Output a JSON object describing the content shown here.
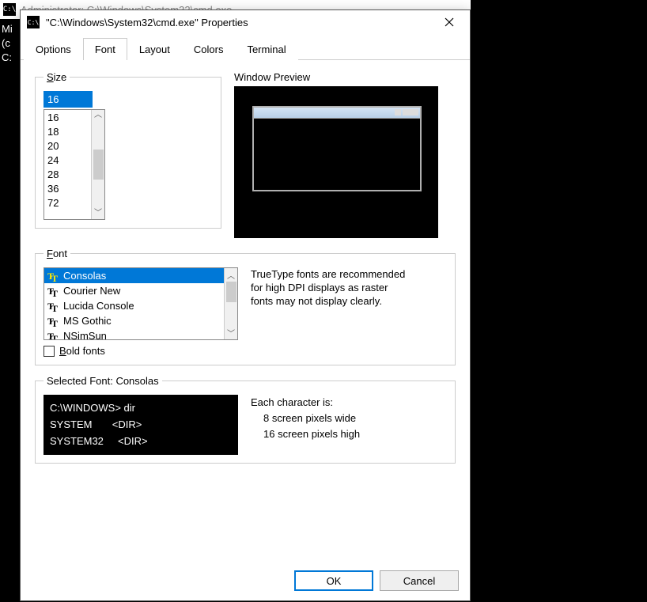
{
  "background": {
    "title_text": "Administrator: C:\\Windows\\System32\\cmd.exe",
    "left_lines": [
      "Mi",
      "(c",
      " ",
      "C:"
    ]
  },
  "dialog": {
    "title": "\"C:\\Windows\\System32\\cmd.exe\" Properties",
    "tabs": [
      "Options",
      "Font",
      "Layout",
      "Colors",
      "Terminal"
    ],
    "active_tab": "Font",
    "size": {
      "legend": "Size",
      "current": "16",
      "options": [
        "16",
        "18",
        "20",
        "24",
        "28",
        "36",
        "72"
      ]
    },
    "preview": {
      "label": "Window Preview"
    },
    "font": {
      "legend": "Font",
      "options": [
        "Consolas",
        "Courier New",
        "Lucida Console",
        "MS Gothic",
        "NSimSun"
      ],
      "selected": "Consolas",
      "bold_label": "Bold fonts",
      "hint": "TrueType fonts are recommended for high DPI displays as raster fonts may not display clearly."
    },
    "selected_font": {
      "legend": "Selected Font: Consolas",
      "sample_lines": [
        "C:\\WINDOWS> dir",
        "SYSTEM       <DIR>",
        "SYSTEM32     <DIR>"
      ],
      "char_label": "Each character is:",
      "char_w": "  8 screen pixels wide",
      "char_h": "16 screen pixels high"
    },
    "buttons": {
      "ok": "OK",
      "cancel": "Cancel"
    }
  }
}
